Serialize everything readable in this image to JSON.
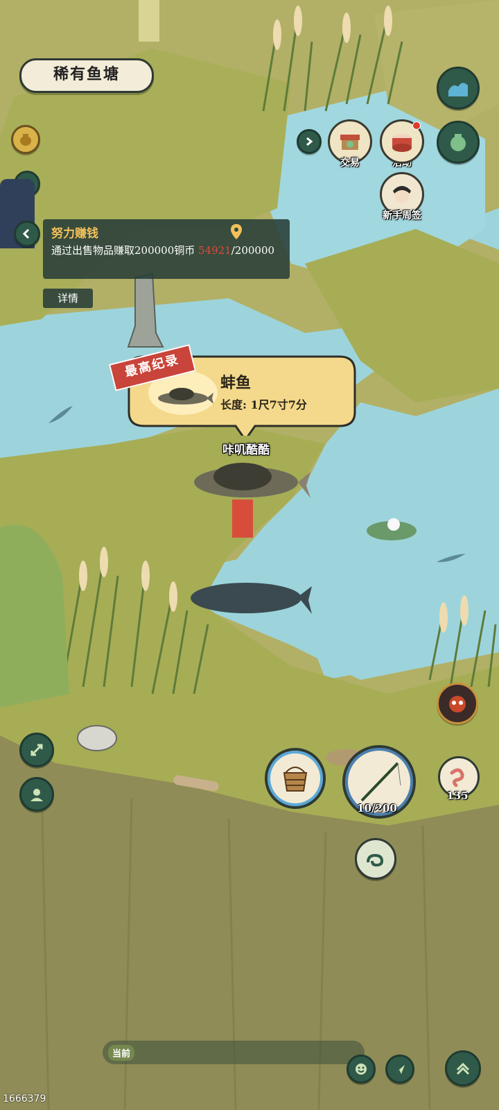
{
  "location": {
    "name": "稀有鱼塘"
  },
  "top_menu": {
    "trade_label": "交易",
    "event_label": "活动",
    "novice_label": "新手周签"
  },
  "task": {
    "title": "努力赚钱",
    "description": "通过出售物品赚取200000铜币",
    "progress_current": "54921",
    "progress_total": "/200000",
    "detail_button": "详情"
  },
  "catch_record": {
    "badge": "最高纪录",
    "fish_name": "蚌鱼",
    "length_label": "长度:",
    "length_value": "1尺7寸7分"
  },
  "player": {
    "name": "咔叽酷酷"
  },
  "fishing": {
    "rod_durability": "10/200",
    "bait_count": "135"
  },
  "bottom": {
    "channel_label": "当前"
  },
  "user_id": "1666379",
  "colors": {
    "water": "#9dd4dc",
    "grass": "#a6ad55",
    "ui_dark_green": "#2f5a4a",
    "task_title": "#f3c05a",
    "progress_red": "#e04a3a"
  },
  "icons": [
    "water-wave-icon",
    "bag-icon",
    "trade-stall-icon",
    "drum-icon",
    "expand-arrow-icon",
    "bucket-icon",
    "fishing-rod-icon",
    "worm-bait-icon",
    "cloud-swirl-icon",
    "fullscreen-icon",
    "avatar-icon",
    "emoji-icon",
    "chat-send-icon",
    "chevron-up-icon",
    "map-pin-icon",
    "monster-badge-icon",
    "pot-icon"
  ]
}
